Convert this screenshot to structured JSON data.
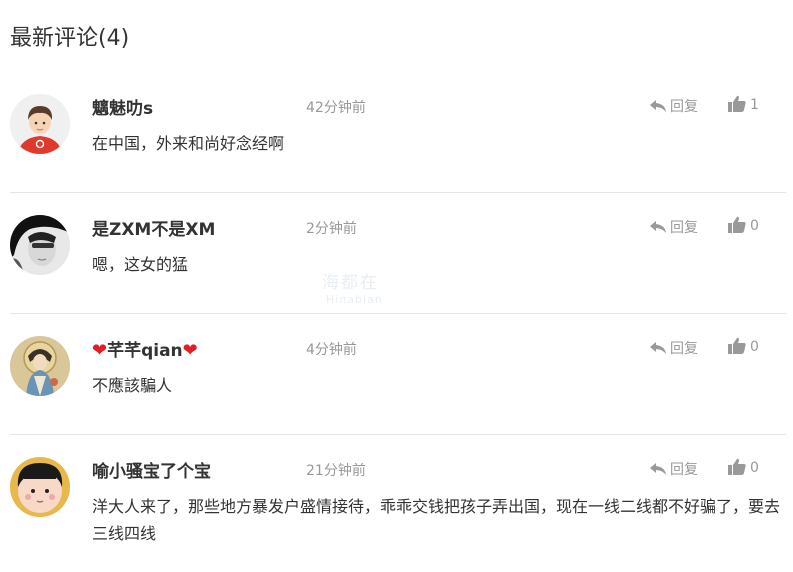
{
  "section": {
    "title": "最新评论(4)"
  },
  "watermark": {
    "cn": "海都在",
    "en": "Hinabian"
  },
  "comments": [
    {
      "username": "魑魅叻s",
      "time": "42分钟前",
      "reply_label": "回复",
      "likes": "1",
      "text": "在中国，外来和尚好念经啊"
    },
    {
      "username": "是ZXM不是XM",
      "time": "2分钟前",
      "reply_label": "回复",
      "likes": "0",
      "text": "嗯，这女的猛"
    },
    {
      "username": "芊芊qian",
      "time": "4分钟前",
      "reply_label": "回复",
      "likes": "0",
      "text": "不應該騙人"
    },
    {
      "username": "喻小骚宝了个宝",
      "time": "21分钟前",
      "reply_label": "回复",
      "likes": "0",
      "text": "洋大人来了，那些地方暴发户盛情接待，乖乖交钱把孩子弄出国，现在一线二线都不好骗了，要去三线四线"
    }
  ]
}
